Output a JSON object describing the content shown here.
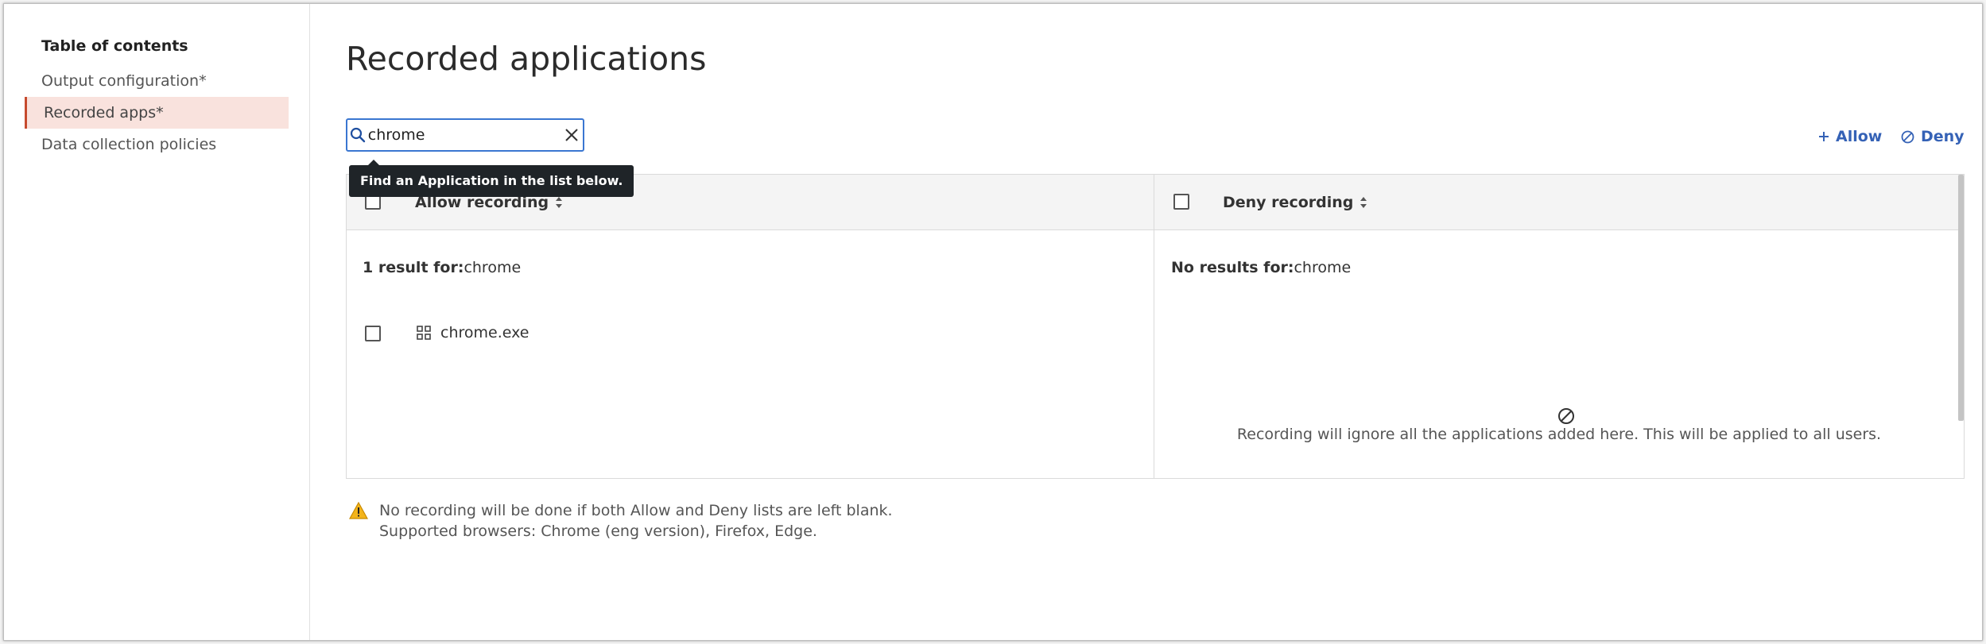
{
  "sidebar": {
    "title": "Table of contents",
    "items": [
      {
        "label": "Output configuration*"
      },
      {
        "label": "Recorded apps*"
      },
      {
        "label": "Data collection policies"
      }
    ]
  },
  "main": {
    "title": "Recorded applications",
    "search": {
      "value": "chrome",
      "tooltip": "Find an Application in the list below."
    },
    "actions": {
      "allow_label": "Allow",
      "deny_label": "Deny"
    },
    "allow_column": {
      "header": "Allow recording",
      "result_prefix": "1 result for:",
      "result_query": "chrome",
      "apps": [
        {
          "name": "chrome.exe"
        }
      ]
    },
    "deny_column": {
      "header": "Deny recording",
      "result_prefix": "No results for:",
      "result_query": "chrome",
      "empty_message": "Recording will ignore all the applications added here. This will be applied to all users."
    },
    "notice": {
      "line1": "No recording will be done if both Allow and Deny lists are left blank.",
      "line2": "Supported browsers: Chrome (eng version), Firefox, Edge."
    }
  },
  "colors": {
    "accent": "#3a76d1",
    "active_nav_bg": "#f9e2dd",
    "active_nav_border": "#c64a2e",
    "warning": "#e0a21c"
  }
}
